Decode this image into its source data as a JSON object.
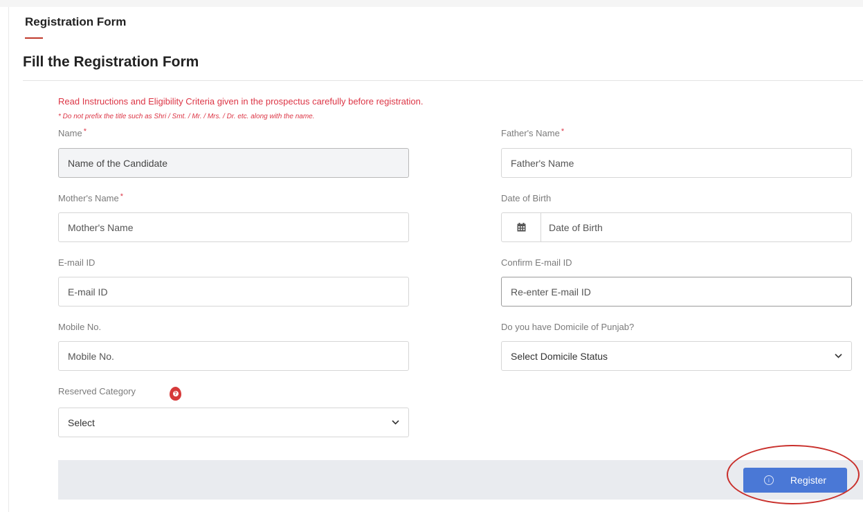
{
  "header": {
    "tab_title": "Registration Form",
    "page_title": "Fill the Registration Form"
  },
  "notices": {
    "main": "Read Instructions and Eligibility Criteria given in the prospectus carefully before registration.",
    "small": "* Do not prefix the title such as Shri / Smt. / Mr. / Mrs. / Dr. etc. along with the name."
  },
  "form": {
    "name": {
      "label": "Name",
      "required_mark": "*",
      "placeholder": "Name of the Candidate"
    },
    "father_name": {
      "label": "Father's Name",
      "required_mark": "*",
      "placeholder": "Father's Name"
    },
    "mother_name": {
      "label": "Mother's Name",
      "required_mark": "*",
      "placeholder": "Mother's Name"
    },
    "dob": {
      "label": "Date of Birth",
      "placeholder": "Date of Birth",
      "icon": "calendar-icon"
    },
    "email": {
      "label": "E-mail ID",
      "placeholder": "E-mail ID"
    },
    "confirm_email": {
      "label": "Confirm E-mail ID",
      "placeholder": "Re-enter E-mail ID"
    },
    "mobile": {
      "label": "Mobile No.",
      "placeholder": "Mobile No."
    },
    "domicile": {
      "label": "Do you have Domicile of Punjab?",
      "selected": "Select Domicile Status"
    },
    "category": {
      "label": "Reserved Category",
      "selected": "Select",
      "help_icon": "question-icon"
    }
  },
  "footer": {
    "register_label": "Register",
    "icon": "info-icon"
  },
  "colors": {
    "accent_red": "#dc3545",
    "button_blue": "#4a78d6",
    "annotation": "#c9302c"
  }
}
